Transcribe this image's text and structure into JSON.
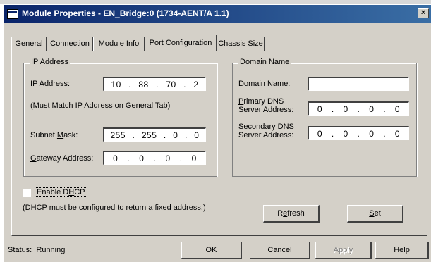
{
  "window": {
    "title": "Module Properties - EN_Bridge:0 (1734-AENT/A 1.1)",
    "close_glyph": "×"
  },
  "tabs": [
    {
      "label": "General"
    },
    {
      "label": "Connection"
    },
    {
      "label": "Module Info"
    },
    {
      "label": "Port Configuration",
      "active": true
    },
    {
      "label": "Chassis Size"
    }
  ],
  "ip_group": {
    "title": "IP Address",
    "ip_label": "IP Address:",
    "ip_value": [
      "10",
      "88",
      "70",
      "2"
    ],
    "must_match_note": "(Must Match IP Address on General Tab)",
    "subnet_label": "Subnet Mask:",
    "subnet_value": [
      "255",
      "255",
      "0",
      "0"
    ],
    "gateway_label": "Gateway Address:",
    "gateway_value": [
      "0",
      "0",
      "0",
      "0"
    ]
  },
  "domain_group": {
    "title": "Domain Name",
    "domain_label": "Domain Name:",
    "domain_value": "",
    "primary_dns_label_1": "Primary DNS",
    "primary_dns_label_2": "Server Address:",
    "primary_dns_value": [
      "0",
      "0",
      "0",
      "0"
    ],
    "secondary_dns_label_1": "Secondary DNS",
    "secondary_dns_label_2": "Server Address:",
    "secondary_dns_value": [
      "0",
      "0",
      "0",
      "0"
    ]
  },
  "dhcp": {
    "label": "Enable DHCP",
    "checked": false,
    "note": "(DHCP must be configured to return a fixed address.)"
  },
  "buttons": {
    "refresh": "Refresh",
    "set": "Set",
    "ok": "OK",
    "cancel": "Cancel",
    "apply": "Apply",
    "help": "Help"
  },
  "status": {
    "label": "Status:",
    "value": "Running"
  },
  "colors": {
    "title_bar_start": "#0a246a",
    "title_bar_end": "#3a6ea5",
    "dialog_face": "#d4d0c8"
  }
}
